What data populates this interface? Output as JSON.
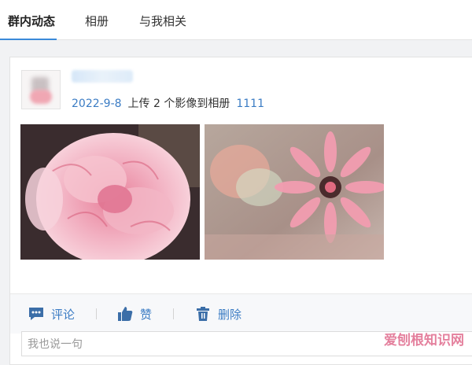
{
  "tabs": [
    {
      "label": "群内动态",
      "active": true
    },
    {
      "label": "相册",
      "active": false
    },
    {
      "label": "与我相关",
      "active": false
    }
  ],
  "post": {
    "date": "2022-9-8",
    "action_text": "上传 2 个影像到相册",
    "album_name": "1111",
    "photos": [
      {
        "subject": "pink carnation"
      },
      {
        "subject": "pink gerbera daisy"
      }
    ]
  },
  "actions": {
    "comment_label": "评论",
    "like_label": "赞",
    "delete_label": "删除"
  },
  "comment_input": {
    "placeholder": "我也说一句"
  },
  "watermark": "爱刨根知识网",
  "colors": {
    "link": "#3b7cc4",
    "tab_underline": "#3b8ad9",
    "background": "#f1f2f4"
  }
}
